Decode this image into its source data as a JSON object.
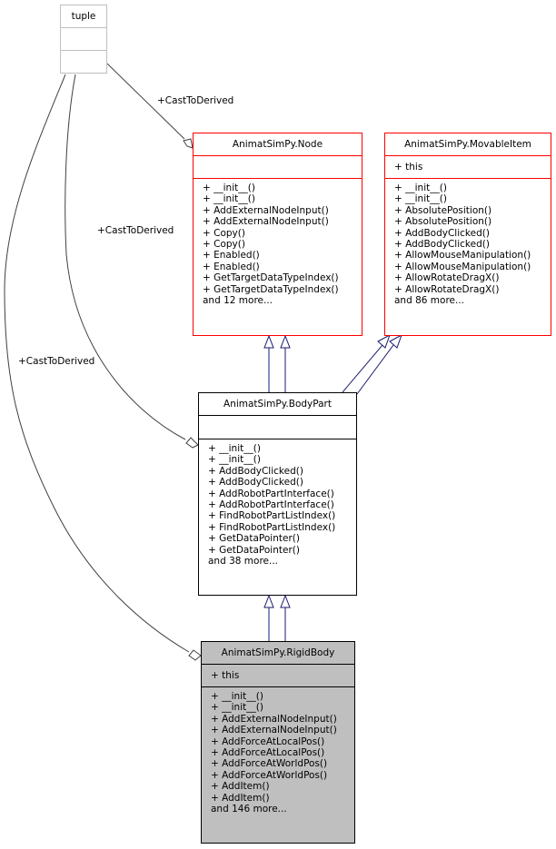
{
  "diagram": {
    "classes": {
      "tuple": {
        "name": "tuple",
        "attributes": [],
        "operations": []
      },
      "node": {
        "name": "AnimatSimPy.Node",
        "attributes": [],
        "operations": [
          "+ __init__()",
          "+ __init__()",
          "+ AddExternalNodeInput()",
          "+ AddExternalNodeInput()",
          "+ Copy()",
          "+ Copy()",
          "+ Enabled()",
          "+ Enabled()",
          "+ GetTargetDataTypeIndex()",
          "+ GetTargetDataTypeIndex()",
          "and 12 more..."
        ]
      },
      "movable_item": {
        "name": "AnimatSimPy.MovableItem",
        "attributes": [
          "+ this"
        ],
        "operations": [
          "+ __init__()",
          "+ __init__()",
          "+ AbsolutePosition()",
          "+ AbsolutePosition()",
          "+ AddBodyClicked()",
          "+ AddBodyClicked()",
          "+ AllowMouseManipulation()",
          "+ AllowMouseManipulation()",
          "+ AllowRotateDragX()",
          "+ AllowRotateDragX()",
          "and 86 more..."
        ]
      },
      "body_part": {
        "name": "AnimatSimPy.BodyPart",
        "attributes": [],
        "operations": [
          "+ __init__()",
          "+ __init__()",
          "+ AddBodyClicked()",
          "+ AddBodyClicked()",
          "+ AddRobotPartInterface()",
          "+ AddRobotPartInterface()",
          "+ FindRobotPartListIndex()",
          "+ FindRobotPartListIndex()",
          "+ GetDataPointer()",
          "+ GetDataPointer()",
          "and 38 more..."
        ]
      },
      "rigid_body": {
        "name": "AnimatSimPy.RigidBody",
        "attributes": [
          "+ this"
        ],
        "operations": [
          "+ __init__()",
          "+ __init__()",
          "+ AddExternalNodeInput()",
          "+ AddExternalNodeInput()",
          "+ AddForceAtLocalPos()",
          "+ AddForceAtLocalPos()",
          "+ AddForceAtWorldPos()",
          "+ AddForceAtWorldPos()",
          "+ AddItem()",
          "+ AddItem()",
          "and 146 more..."
        ]
      }
    },
    "edge_labels": {
      "tuple_to_node": "+CastToDerived",
      "tuple_to_bodypart": "+CastToDerived",
      "tuple_to_rigidbody": "+CastToDerived"
    },
    "colors": {
      "incomplete_border": "#ff0000",
      "selected_fill": "#bfbfbf",
      "inheritance_edge": "#191970",
      "usage_edge": "#404040",
      "external_border": "#bfbfbf"
    }
  }
}
